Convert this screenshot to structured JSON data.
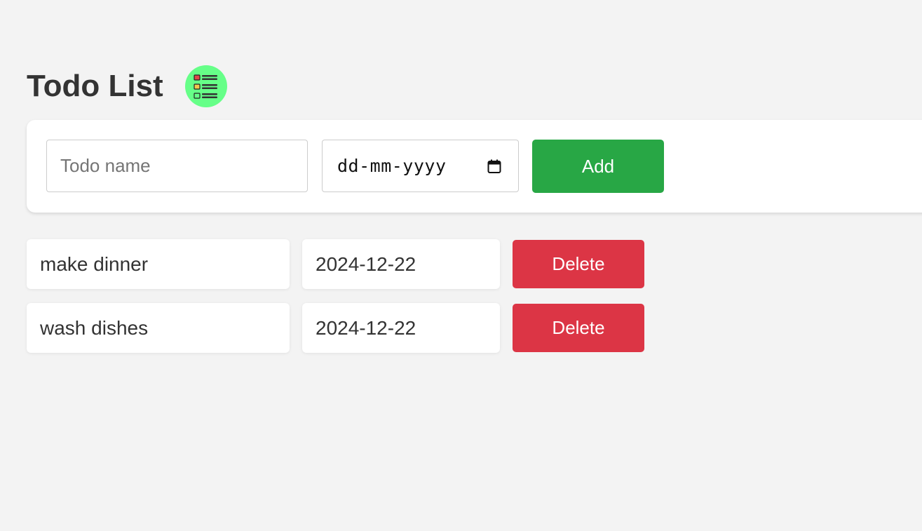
{
  "header": {
    "title": "Todo List",
    "logo_icon": "todo-list-icon",
    "logo_bg": "#66ff88"
  },
  "form": {
    "name_placeholder": "Todo name",
    "name_value": "",
    "date_placeholder": "dd-mm-yyyy",
    "calendar_icon": "calendar-icon",
    "add_label": "Add",
    "add_color": "#28a745"
  },
  "todos": [
    {
      "name": "make dinner",
      "date": "2024-12-22",
      "delete_label": "Delete"
    },
    {
      "name": "wash dishes",
      "date": "2024-12-22",
      "delete_label": "Delete"
    }
  ],
  "colors": {
    "background": "#f3f3f3",
    "delete": "#dc3545",
    "text": "#333333"
  }
}
